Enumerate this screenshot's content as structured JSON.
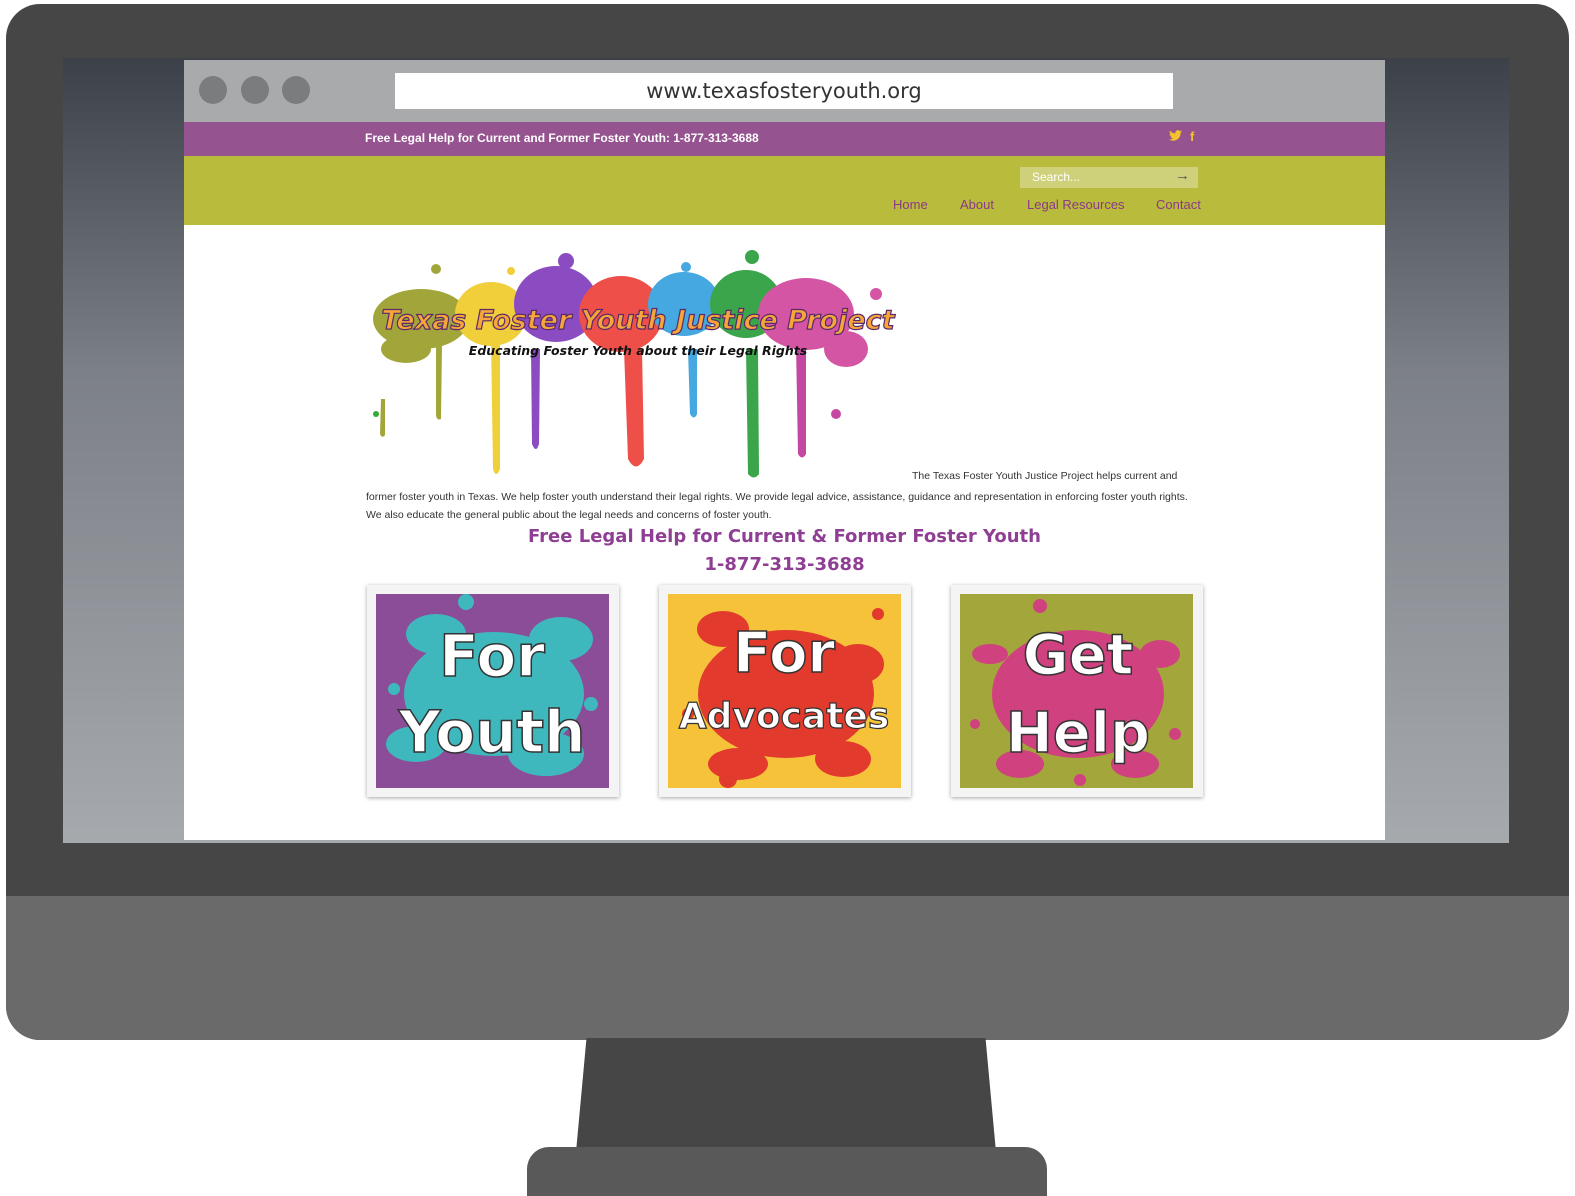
{
  "browser": {
    "url": "www.texasfosteryouth.org"
  },
  "topbar": {
    "text": "Free Legal Help for Current and Former Foster Youth: 1-877-313-3688",
    "social_icons": [
      "twitter-icon",
      "facebook-icon"
    ],
    "twitter_glyph": "🐦",
    "facebook_glyph": "f"
  },
  "search": {
    "placeholder": "Search...",
    "submit_glyph": "→"
  },
  "nav": {
    "items": [
      "Home",
      "About",
      "Legal Resources",
      "Contact"
    ]
  },
  "logo": {
    "title": "Texas Foster Youth Justice Project",
    "tagline": "Educating Foster Youth about their Legal Rights"
  },
  "intro": {
    "line1": "The Texas Foster Youth Justice Project helps current and",
    "rest": "former foster youth in Texas. We help foster youth understand their legal rights. We provide legal advice, assistance, guidance and representation in enforcing foster youth rights. We also educate the general public about the legal needs and concerns of foster youth."
  },
  "headline": {
    "line1": "Free Legal Help for Current & Former Foster Youth",
    "line2": "1-877-313-3688"
  },
  "tiles": [
    {
      "line1": "For",
      "line2": "Youth"
    },
    {
      "line1": "For",
      "line2": "Advocates"
    },
    {
      "line1": "Get",
      "line2": "Help"
    }
  ],
  "colors": {
    "topbar": "#95538f",
    "navbar": "#b8bb3c",
    "accent_purple": "#8f3f93",
    "tile_youth_bg": "#8b4c98",
    "tile_youth_splash": "#3fb8bd",
    "tile_advocates_bg": "#f5c23a",
    "tile_advocates_splash": "#e23a2c",
    "tile_help_bg": "#a3a63a",
    "tile_help_splash": "#d0417f"
  }
}
